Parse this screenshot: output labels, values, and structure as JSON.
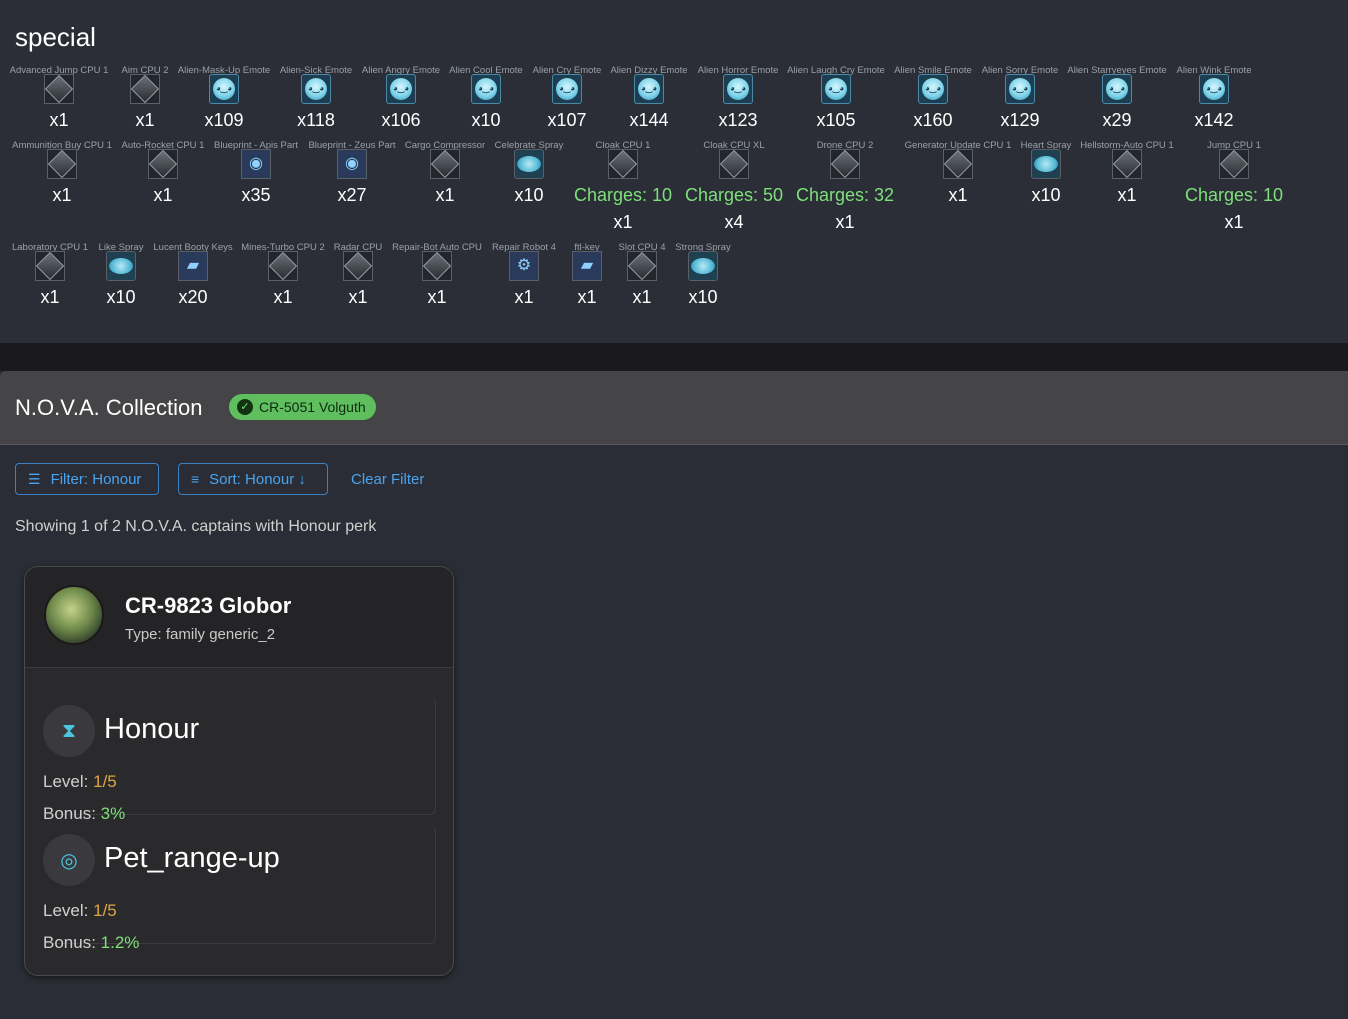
{
  "special": {
    "title": "special",
    "rows": [
      [
        {
          "label": "Advanced Jump CPU 1",
          "count": "x1",
          "icon": "cpu-icon"
        },
        {
          "label": "Aim CPU 2",
          "count": "x1",
          "icon": "cpu-icon"
        },
        {
          "label": "Alien-Mask-Up Emote",
          "count": "x109",
          "icon": "alien-emote-icon"
        },
        {
          "label": "Alien-Sick Emote",
          "count": "x118",
          "icon": "alien-emote-icon"
        },
        {
          "label": "Alien Angry Emote",
          "count": "x106",
          "icon": "alien-emote-icon"
        },
        {
          "label": "Alien Cool Emote",
          "count": "x10",
          "icon": "alien-emote-icon"
        },
        {
          "label": "Alien Cry Emote",
          "count": "x107",
          "icon": "alien-emote-icon"
        },
        {
          "label": "Alien Dizzy Emote",
          "count": "x144",
          "icon": "alien-emote-icon"
        },
        {
          "label": "Alien Horror Emote",
          "count": "x123",
          "icon": "alien-emote-icon"
        },
        {
          "label": "Alien Laugh Cry Emote",
          "count": "x105",
          "icon": "alien-emote-icon"
        },
        {
          "label": "Alien Smile Emote",
          "count": "x160",
          "icon": "alien-emote-icon"
        },
        {
          "label": "Alien Sorry Emote",
          "count": "x129",
          "icon": "alien-emote-icon"
        },
        {
          "label": "Alien Starryeyes Emote",
          "count": "x29",
          "icon": "alien-emote-icon"
        },
        {
          "label": "Alien Wink Emote",
          "count": "x142",
          "icon": "alien-emote-icon"
        }
      ],
      [
        {
          "label": "Ammunition Buy CPU 1",
          "count": "x1",
          "icon": "cpu-icon"
        },
        {
          "label": "Auto-Rocket CPU 1",
          "count": "x1",
          "icon": "cpu-icon"
        },
        {
          "label": "Blueprint - Apis Part",
          "count": "x35",
          "icon": "blueprint-icon"
        },
        {
          "label": "Blueprint - Zeus Part",
          "count": "x27",
          "icon": "blueprint-icon"
        },
        {
          "label": "Cargo Compressor",
          "count": "x1",
          "icon": "cpu-icon"
        },
        {
          "label": "Celebrate Spray",
          "count": "x10",
          "icon": "spray-icon"
        },
        {
          "label": "Cloak CPU 1",
          "charges": "Charges: 10",
          "count": "x1",
          "icon": "cpu-icon"
        },
        {
          "label": "Cloak CPU XL",
          "charges": "Charges: 50",
          "count": "x4",
          "icon": "cpu-icon"
        },
        {
          "label": "Drone CPU 2",
          "charges": "Charges: 32",
          "count": "x1",
          "icon": "cpu-icon"
        },
        {
          "label": "Generator Update CPU 1",
          "count": "x1",
          "icon": "cpu-icon"
        },
        {
          "label": "Heart Spray",
          "count": "x10",
          "icon": "spray-icon"
        },
        {
          "label": "Hellstorm-Auto CPU 1",
          "count": "x1",
          "icon": "cpu-icon"
        },
        {
          "label": "Jump CPU 1",
          "charges": "Charges: 10",
          "count": "x1",
          "icon": "cpu-icon"
        }
      ],
      [
        {
          "label": "Laboratory CPU 1",
          "count": "x1",
          "icon": "cpu-icon"
        },
        {
          "label": "Like Spray",
          "count": "x10",
          "icon": "spray-icon"
        },
        {
          "label": "Lucent Booty Keys",
          "count": "x20",
          "icon": "key-icon"
        },
        {
          "label": "Mines-Turbo CPU 2",
          "count": "x1",
          "icon": "cpu-icon"
        },
        {
          "label": "Radar CPU",
          "count": "x1",
          "icon": "cpu-icon"
        },
        {
          "label": "Repair-Bot Auto CPU",
          "count": "x1",
          "icon": "cpu-icon"
        },
        {
          "label": "Repair Robot 4",
          "count": "x1",
          "icon": "robot-icon"
        },
        {
          "label": "ftl-key",
          "count": "x1",
          "icon": "key-icon"
        },
        {
          "label": "Slot CPU 4",
          "count": "x1",
          "icon": "cpu-icon"
        },
        {
          "label": "Strong Spray",
          "count": "x10",
          "icon": "spray-icon"
        }
      ]
    ]
  },
  "nova": {
    "title": "N.O.V.A. Collection",
    "chip": "CR-5051 Volguth",
    "filter_label": "Filter: Honour",
    "sort_label": "Sort: Honour ↓",
    "clear_label": "Clear Filter",
    "showing": "Showing 1 of 2 N.O.V.A. captains with Honour perk",
    "captain": {
      "name": "CR-9823 Globor",
      "type": "Type: family generic_2",
      "perks": [
        {
          "name": "Honour",
          "level_label": "Level:",
          "level": "1/5",
          "bonus_label": "Bonus:",
          "bonus": "3%",
          "icon": "hourglass-icon"
        },
        {
          "name": "Pet_range-up",
          "level_label": "Level:",
          "level": "1/5",
          "bonus_label": "Bonus:",
          "bonus": "1.2%",
          "icon": "pet-range-icon"
        }
      ]
    }
  },
  "colors": {
    "accent": "#4aa3ee",
    "charges": "#7ee07a",
    "level": "#e0a73c",
    "chip": "#5fbf5f"
  }
}
